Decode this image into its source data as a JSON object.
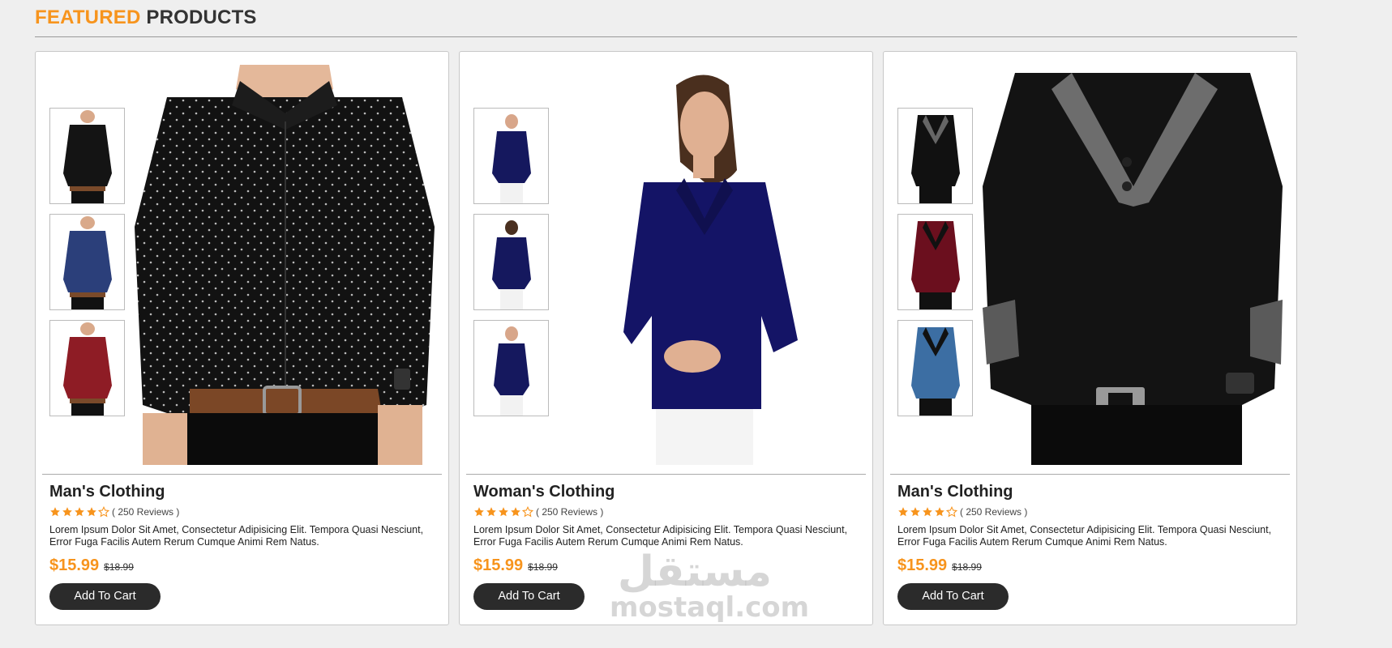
{
  "section": {
    "title_accent": "FEATURED",
    "title_rest": "PRODUCTS"
  },
  "colors": {
    "accent": "#f7941d",
    "button_bg": "#2b2b2b",
    "page_bg": "#efefef"
  },
  "products": [
    {
      "title": "Man's Clothing",
      "reviews": "( 250 Reviews )",
      "rating": 4,
      "description": "Lorem Ipsum Dolor Sit Amet, Consectetur Adipisicing Elit. Tempora Quasi Nesciunt, Error Fuga Facilis Autem Rerum Cumque Animi Rem Natus.",
      "price": "$15.99",
      "old_price": "$18.99",
      "cart_label": "Add To Cart",
      "main_image": "man-black-dotted-shirt",
      "thumbnails": [
        "black-shirt-thumb",
        "navy-shirt-thumb",
        "red-shirt-thumb"
      ]
    },
    {
      "title": "Woman's Clothing",
      "reviews": "( 250 Reviews )",
      "rating": 4,
      "description": "Lorem Ipsum Dolor Sit Amet, Consectetur Adipisicing Elit. Tempora Quasi Nesciunt, Error Fuga Facilis Autem Rerum Cumque Animi Rem Natus.",
      "price": "$15.99",
      "old_price": "$18.99",
      "cart_label": "Add To Cart",
      "main_image": "woman-navy-blouse",
      "thumbnails": [
        "navy-blouse-front-thumb",
        "navy-blouse-back-thumb",
        "navy-blouse-side-thumb"
      ]
    },
    {
      "title": "Man's Clothing",
      "reviews": "( 250 Reviews )",
      "rating": 4,
      "description": "Lorem Ipsum Dolor Sit Amet, Consectetur Adipisicing Elit. Tempora Quasi Nesciunt, Error Fuga Facilis Autem Rerum Cumque Animi Rem Natus.",
      "price": "$15.99",
      "old_price": "$18.99",
      "cart_label": "Add To Cart",
      "main_image": "man-black-cowl-tshirt",
      "thumbnails": [
        "black-cowl-thumb",
        "maroon-cowl-thumb",
        "blue-cowl-thumb"
      ]
    }
  ],
  "watermark": {
    "arabic": "مستقل",
    "latin": "mostaql.com"
  }
}
